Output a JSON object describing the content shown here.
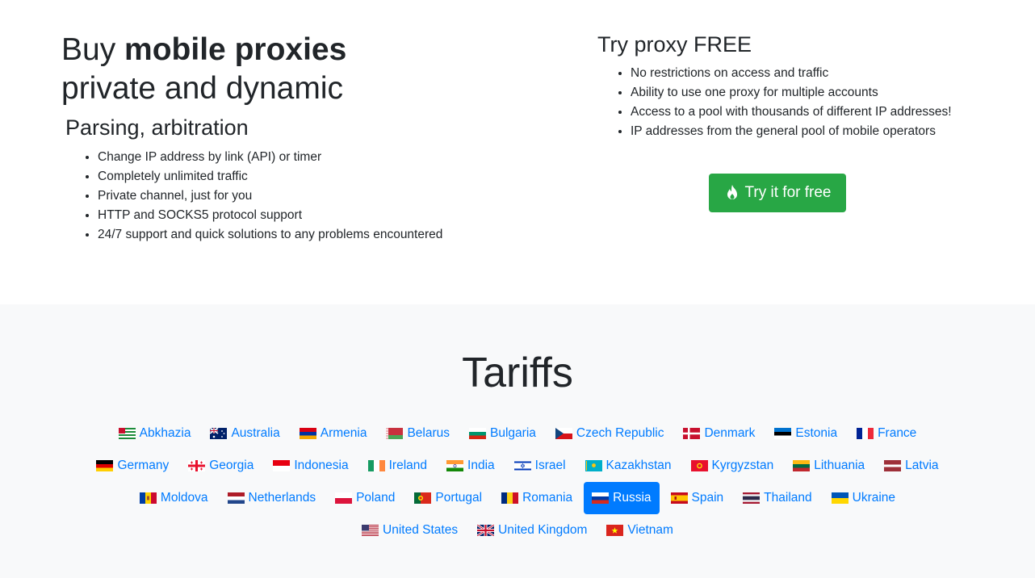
{
  "hero": {
    "title_prefix": "Buy",
    "title_bold": "mobile proxies",
    "title_line2": "private and dynamic",
    "subtitle": "Parsing, arbitration",
    "features": [
      "Change IP address by link (API) or timer",
      "Completely unlimited traffic",
      "Private channel, just for you",
      "HTTP and SOCKS5 protocol support",
      "24/7 support and quick solutions to any problems encountered"
    ]
  },
  "free": {
    "title": "Try proxy FREE",
    "features": [
      "No restrictions on access and traffic",
      "Ability to use one proxy for multiple accounts",
      "Access to a pool with thousands of different IP addresses!",
      "IP addresses from the general pool of mobile operators"
    ],
    "button_label": "Try it for free",
    "button_icon": "flame-icon",
    "button_color": "#28a745"
  },
  "tariffs": {
    "title": "Tariffs",
    "link_color": "#007bff",
    "active_color": "#007bff",
    "selected": "Russia",
    "countries": [
      {
        "name": "Abkhazia",
        "flag": "abkhazia"
      },
      {
        "name": "Australia",
        "flag": "australia"
      },
      {
        "name": "Armenia",
        "flag": "armenia"
      },
      {
        "name": "Belarus",
        "flag": "belarus"
      },
      {
        "name": "Bulgaria",
        "flag": "bulgaria"
      },
      {
        "name": "Czech Republic",
        "flag": "czech"
      },
      {
        "name": "Denmark",
        "flag": "denmark"
      },
      {
        "name": "Estonia",
        "flag": "estonia"
      },
      {
        "name": "France",
        "flag": "france"
      },
      {
        "name": "Germany",
        "flag": "germany"
      },
      {
        "name": "Georgia",
        "flag": "georgia"
      },
      {
        "name": "Indonesia",
        "flag": "indonesia"
      },
      {
        "name": "Ireland",
        "flag": "ireland"
      },
      {
        "name": "India",
        "flag": "india"
      },
      {
        "name": "Israel",
        "flag": "israel"
      },
      {
        "name": "Kazakhstan",
        "flag": "kazakhstan"
      },
      {
        "name": "Kyrgyzstan",
        "flag": "kyrgyzstan"
      },
      {
        "name": "Lithuania",
        "flag": "lithuania"
      },
      {
        "name": "Latvia",
        "flag": "latvia"
      },
      {
        "name": "Moldova",
        "flag": "moldova"
      },
      {
        "name": "Netherlands",
        "flag": "netherlands"
      },
      {
        "name": "Poland",
        "flag": "poland"
      },
      {
        "name": "Portugal",
        "flag": "portugal"
      },
      {
        "name": "Romania",
        "flag": "romania"
      },
      {
        "name": "Russia",
        "flag": "russia"
      },
      {
        "name": "Spain",
        "flag": "spain"
      },
      {
        "name": "Thailand",
        "flag": "thailand"
      },
      {
        "name": "Ukraine",
        "flag": "ukraine"
      },
      {
        "name": "United States",
        "flag": "usa"
      },
      {
        "name": "United Kingdom",
        "flag": "uk"
      },
      {
        "name": "Vietnam",
        "flag": "vietnam"
      }
    ]
  }
}
